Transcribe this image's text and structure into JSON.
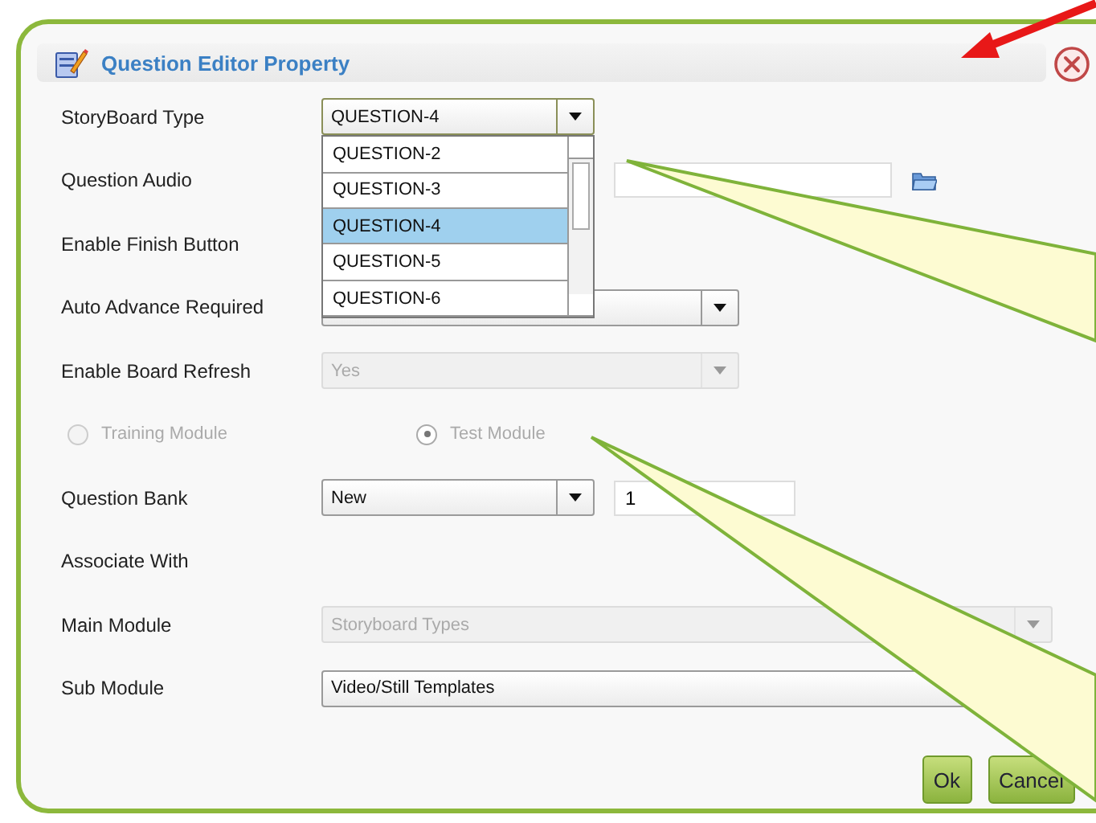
{
  "dialog": {
    "title": "Question Editor Property"
  },
  "fields": [
    {
      "kind": "select",
      "label": "StoryBoard Type",
      "value": "QUESTION-4",
      "disabled": false,
      "open": true
    },
    {
      "kind": "file",
      "label": "Question Audio"
    },
    {
      "kind": "blank",
      "label": "Enable Finish Button"
    },
    {
      "kind": "select",
      "label": "Auto Advance Required",
      "disabled": false
    },
    {
      "kind": "select",
      "label": "Enable Board Refresh",
      "value": "Yes",
      "disabled": true
    },
    {
      "kind": "radios",
      "disabled": true,
      "options": [
        {
          "label": "Training Module",
          "selected": false
        },
        {
          "label": "Test Module",
          "selected": true
        }
      ]
    },
    {
      "kind": "select-input",
      "label": "Question Bank",
      "value": "New",
      "input": "1",
      "disabled": false
    },
    {
      "kind": "blank",
      "label": "Associate With"
    },
    {
      "kind": "wide-select",
      "label": "Main Module",
      "value": "Storyboard Types",
      "disabled": true
    },
    {
      "kind": "wide-select",
      "label": "Sub Module",
      "value": "Video/Still Templates",
      "disabled": false
    }
  ],
  "dropdown": {
    "options": [
      {
        "label": "QUESTION-2",
        "selected": false
      },
      {
        "label": "QUESTION-3",
        "selected": false
      },
      {
        "label": "QUESTION-4",
        "selected": true
      },
      {
        "label": "QUESTION-5",
        "selected": false
      },
      {
        "label": "QUESTION-6",
        "selected": false
      }
    ]
  },
  "buttons": [
    "Ok",
    "Cancel"
  ]
}
